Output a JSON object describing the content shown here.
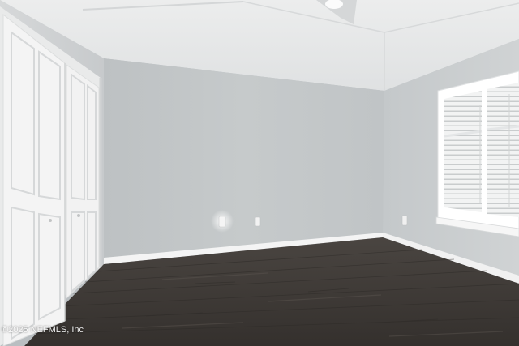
{
  "watermark": {
    "text": "©2025 NEFMLS, Inc"
  },
  "colors": {
    "ceiling": "#e9eaea",
    "back_wall": "#c3c7c9",
    "side_wall": "#c9cdce",
    "baseboard": "#f4f4f4",
    "floor": "#3f3a36",
    "door": "#f3f3f3",
    "window_frame": "#ffffff"
  }
}
